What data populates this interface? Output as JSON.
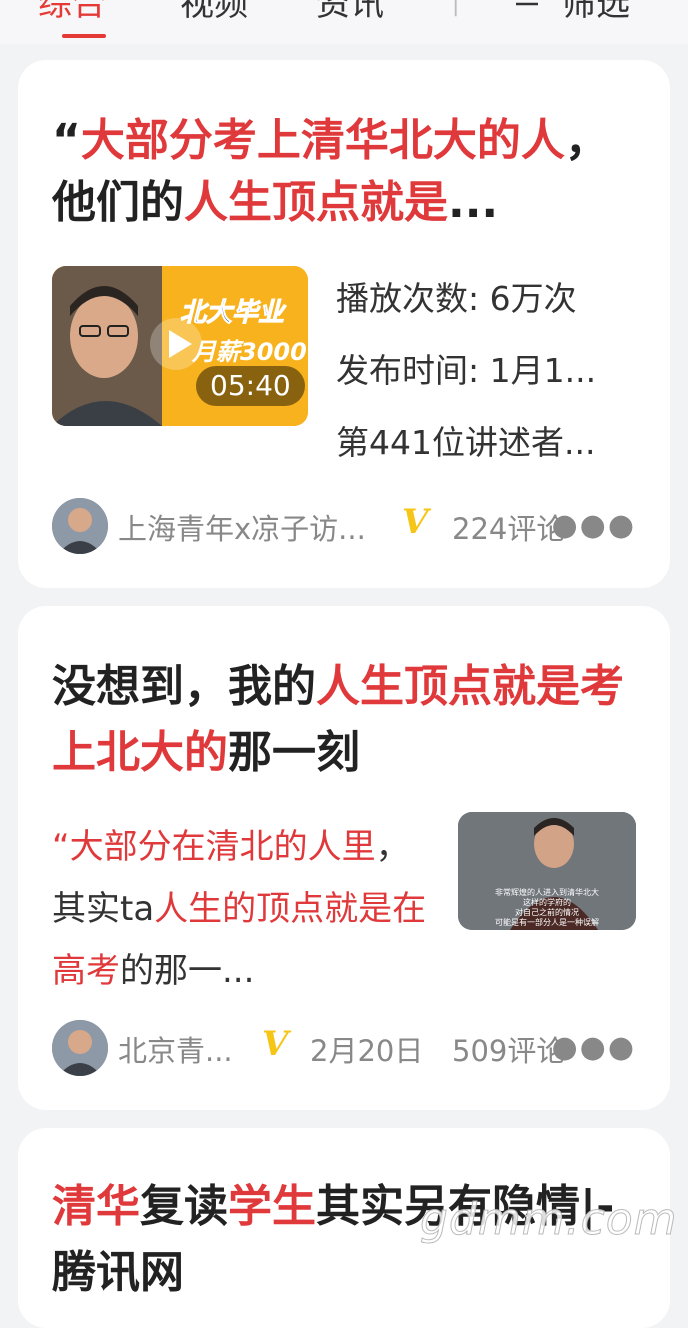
{
  "tabs": [
    {
      "label": "综合",
      "active": true
    },
    {
      "label": "视频",
      "active": false
    },
    {
      "label": "资讯",
      "active": false
    }
  ],
  "filter_label": "筛选",
  "cards": [
    {
      "title_parts": [
        {
          "text": "“",
          "hl": false
        },
        {
          "text": "大部分考上清华北大的人",
          "hl": true
        },
        {
          "text": "，他们的",
          "hl": false
        },
        {
          "text": "人生顶点就是",
          "hl": true
        },
        {
          "text": "...",
          "hl": false
        }
      ],
      "video": {
        "overlay_line1": "北大毕业",
        "overlay_line2": "月薪3000",
        "duration": "05:40"
      },
      "meta": [
        "播放次数: 6万次",
        "发布时间: 1月1...",
        "第441位讲述者..."
      ],
      "author": "上海青年x凉子访...",
      "comments": "224评论"
    },
    {
      "title_parts": [
        {
          "text": "没想到，我的",
          "hl": false
        },
        {
          "text": "人生顶点就是考上北大的",
          "hl": true
        },
        {
          "text": "那一刻",
          "hl": false
        }
      ],
      "excerpt_parts": [
        {
          "text": "“大部分在清北的人里",
          "hl": true
        },
        {
          "text": "，其实ta",
          "hl": false
        },
        {
          "text": "人生的顶点就是在高考",
          "hl": true
        },
        {
          "text": "的那一...",
          "hl": false
        }
      ],
      "thumb_subtitles": [
        "非常辉煌的人进入到清华北大",
        "这样的学府的",
        "对自己之前的情况",
        "可能是有一部分人是一种误解"
      ],
      "author": "北京青...",
      "date": "2月20日",
      "comments": "509评论"
    },
    {
      "title_parts": [
        {
          "text": "清华",
          "hl": true
        },
        {
          "text": "复读",
          "hl": false
        },
        {
          "text": "学生",
          "hl": true
        },
        {
          "text": "其实另有隐情|-腾讯网",
          "hl": false
        }
      ]
    }
  ],
  "watermark": "gdmm.com",
  "colors": {
    "accent": "#e0393b",
    "badge": "#f5c518",
    "background": "#f2f3f5"
  }
}
